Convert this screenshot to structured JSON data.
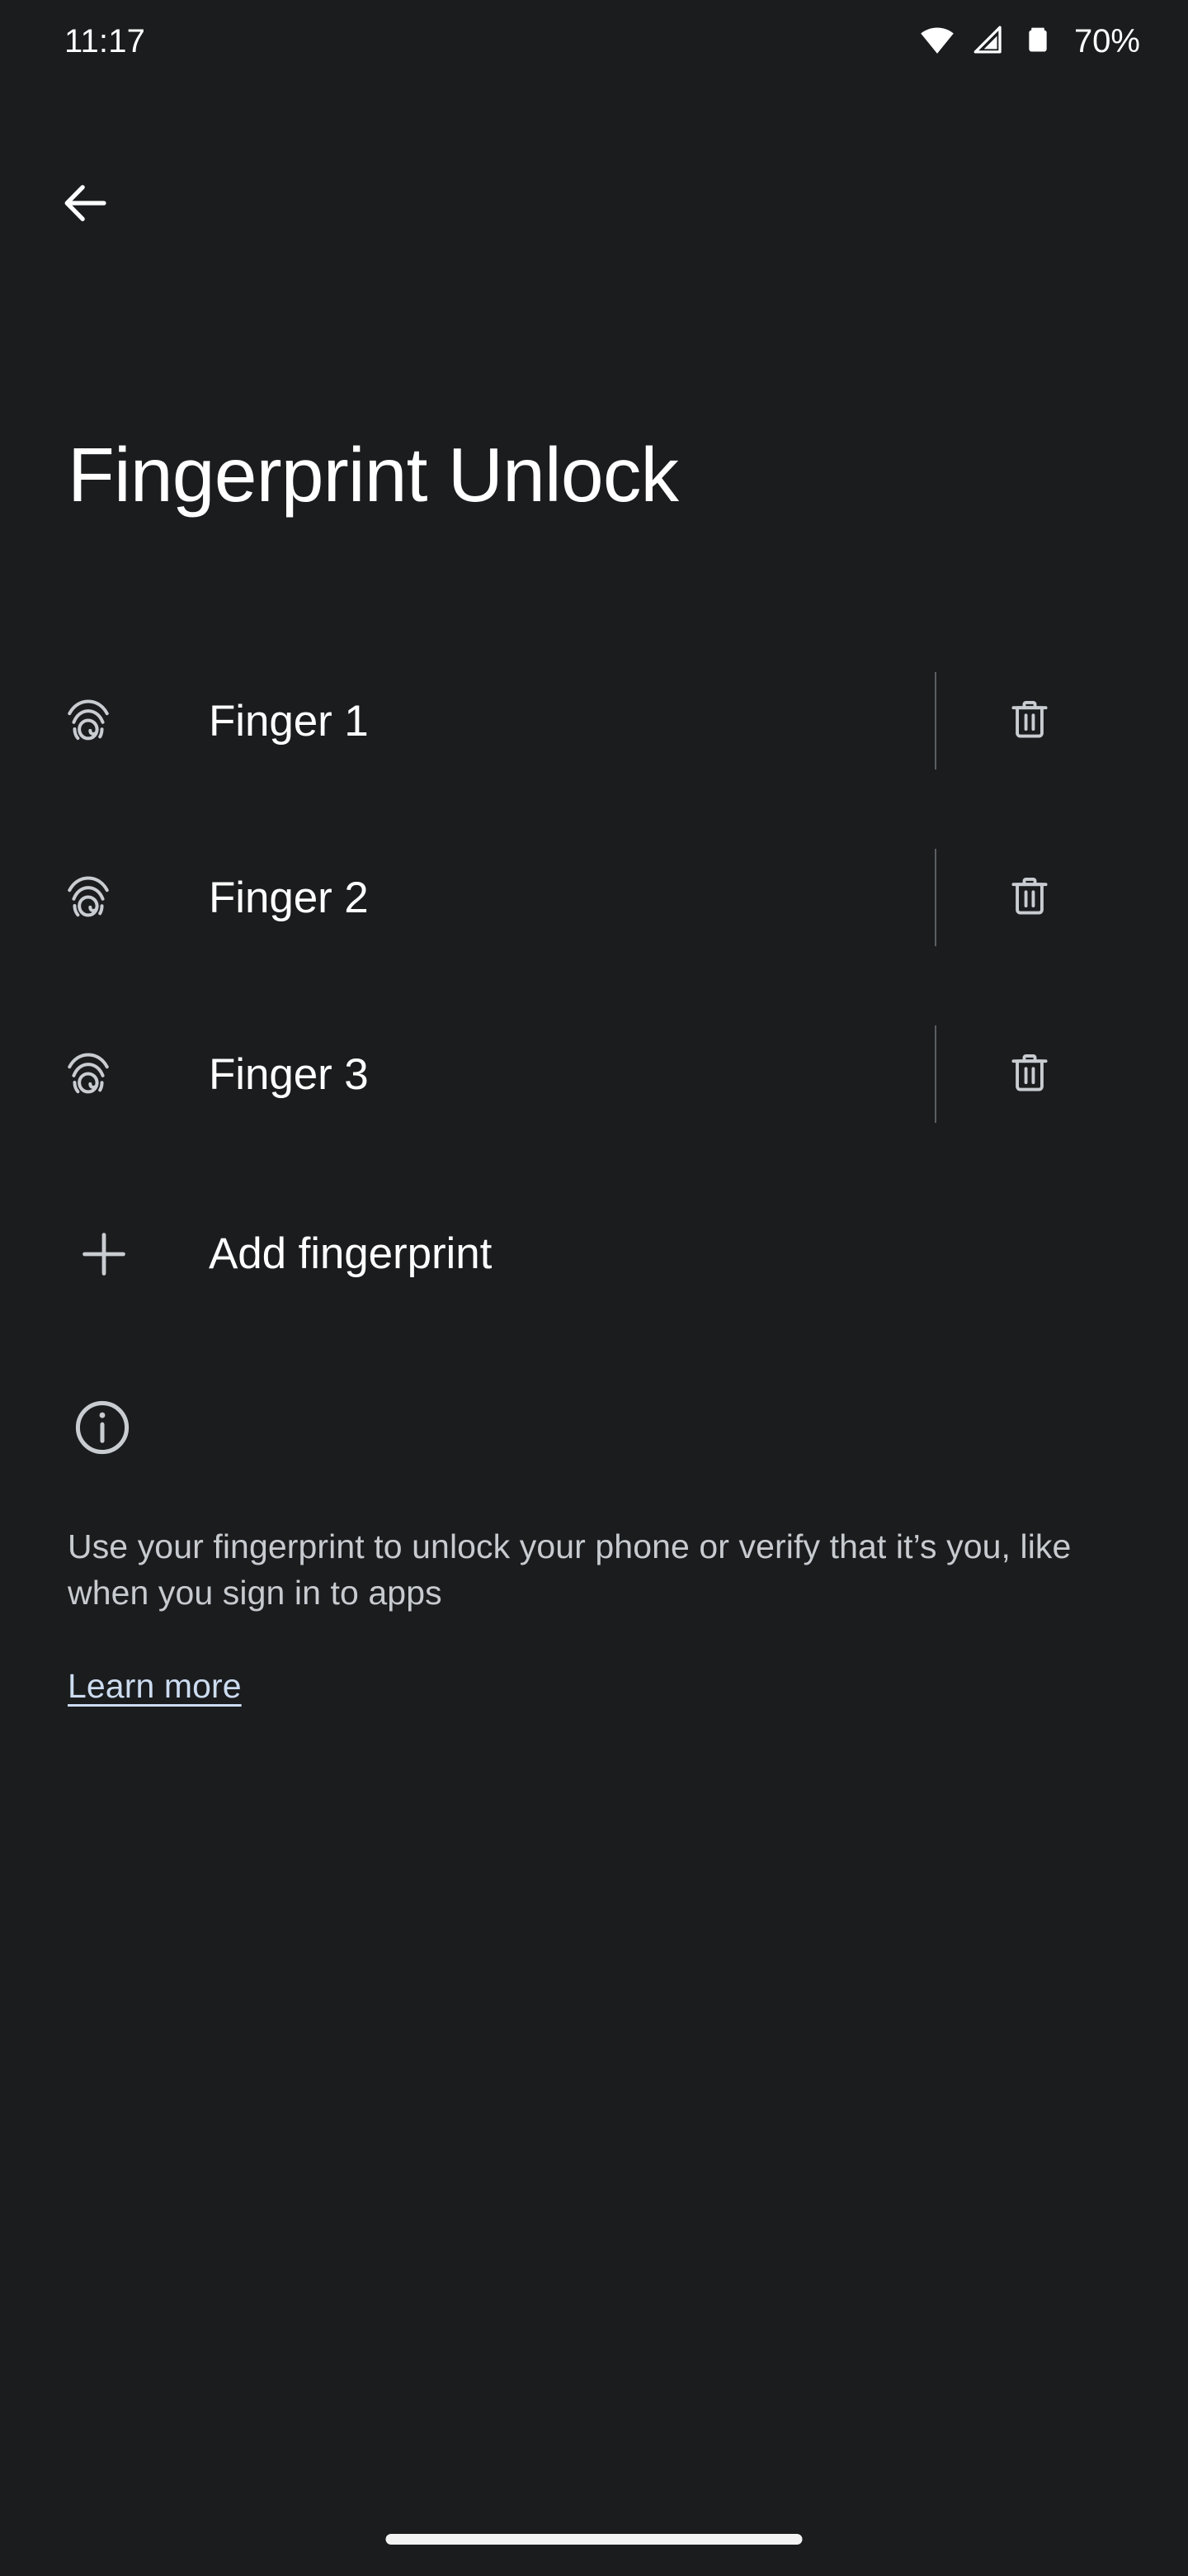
{
  "status_bar": {
    "time": "11:17",
    "battery_percent": "70%",
    "icons": [
      "wifi-icon",
      "cellular-signal-icon",
      "battery-icon"
    ]
  },
  "nav": {
    "back_label": "Back",
    "back_icon": "arrow-left-icon"
  },
  "header": {
    "title": "Fingerprint Unlock"
  },
  "fingerprints": {
    "items": [
      {
        "label": "Finger 1",
        "icon": "fingerprint-icon",
        "delete_icon": "trash-icon"
      },
      {
        "label": "Finger 2",
        "icon": "fingerprint-icon",
        "delete_icon": "trash-icon"
      },
      {
        "label": "Finger 3",
        "icon": "fingerprint-icon",
        "delete_icon": "trash-icon"
      }
    ],
    "add_label": "Add fingerprint",
    "add_icon": "plus-icon"
  },
  "info": {
    "icon": "info-circle-icon",
    "description": "Use your fingerprint to unlock your phone or verify that it’s you, like when you sign in to apps",
    "learn_more_label": "Learn more"
  },
  "system": {
    "home_indicator": "home-indicator"
  },
  "colors": {
    "background": "#1a1c1e",
    "primary_text": "#ffffff",
    "secondary_text": "#c7cbcf",
    "link": "#ccdcf0",
    "divider": "#5a5e62",
    "icon": "#c9cdd1"
  }
}
